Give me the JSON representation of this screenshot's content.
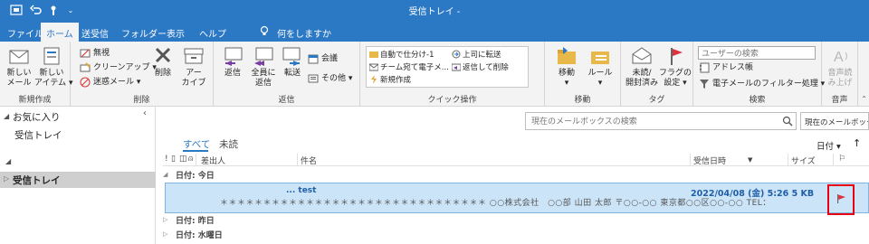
{
  "window": {
    "title": "受信トレイ -"
  },
  "ribbon_tabs": [
    "ファイル",
    "ホーム",
    "送受信",
    "フォルダー",
    "表示",
    "ヘルプ"
  ],
  "tell_me": "何をしますか",
  "groups": {
    "new": {
      "label": "新規作成",
      "new_mail": "新しい\nメール",
      "new_items": "新しい\nアイテム ▾"
    },
    "delete": {
      "label": "削除",
      "ignore": "無視",
      "cleanup": "クリーンアップ ▾",
      "junk": "迷惑メール ▾",
      "delete": "削除",
      "archive": "アー\nカイブ"
    },
    "respond": {
      "label": "返信",
      "reply": "返信",
      "reply_all": "全員に\n返信",
      "forward": "転送",
      "meeting": "会議",
      "more": "その他 ▾"
    },
    "quick_steps": {
      "label": "クイック操作",
      "items": [
        "自動で仕分け-1",
        "上司に転送",
        "チーム宛て電子メ...",
        "返信して削除",
        "新規作成"
      ]
    },
    "move": {
      "label": "移動",
      "move": "移動\n▾",
      "rules": "ルール\n▾"
    },
    "tags": {
      "label": "タグ",
      "unread_read": "未読/\n開封済み",
      "follow_up": "フラグの\n設定 ▾"
    },
    "find": {
      "label": "検索",
      "search_people_placeholder": "ユーザーの検索",
      "address_book": "アドレス帳",
      "filter_email": "電子メールのフィルター処理 ▾"
    },
    "speech": {
      "label": "音声",
      "read_aloud": "音声読\nみ上げ"
    }
  },
  "folder_pane": {
    "favorites": "お気に入り",
    "fav_inbox": "受信トレイ",
    "inbox": "受信トレイ"
  },
  "message_list": {
    "search_placeholder": "現在のメールボックスの検索",
    "search_scope": "現在のメールボックス",
    "filters": {
      "all": "すべて",
      "unread": "未読"
    },
    "sort": "日付 ▾",
    "columns": {
      "from": "差出人",
      "subject": "件名",
      "received": "受信日時",
      "size": "サイズ"
    },
    "groups": {
      "today": "日付: 今日",
      "yesterday": "日付: 昨日",
      "wednesday": "日付: 水曜日"
    },
    "message": {
      "subject": "... test",
      "date": "2022/04/08 (金) 5:26",
      "size": "5 KB",
      "preview": "＊＊＊＊＊＊＊＊＊＊＊＊＊＊＊＊＊＊＊＊＊＊＊＊＊＊＊＊＊＊＊ ○○株式会社　○○部 山田 太郎 〒○○-○○ 東京都○○区○○-○○ TEL："
    }
  },
  "colors": {
    "accent": "#2b78c5",
    "selected_row": "#cce4f7",
    "flag": "#e0303a",
    "highlight_box": "#e60012"
  }
}
